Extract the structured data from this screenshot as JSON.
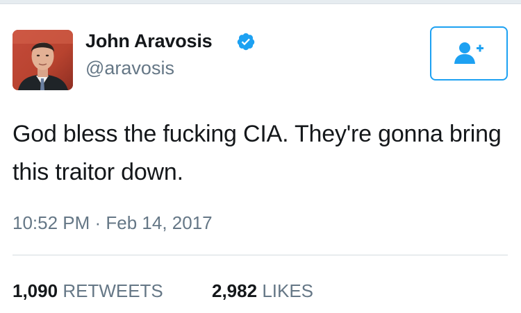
{
  "user": {
    "display_name": "John Aravosis",
    "handle": "@aravosis",
    "verified": true
  },
  "tweet": {
    "text": "God bless the fucking CIA. They're gonna bring this traitor down.",
    "timestamp": "10:52 PM · Feb 14, 2017"
  },
  "stats": {
    "retweets_count": "1,090",
    "retweets_label": "RETWEETS",
    "likes_count": "2,982",
    "likes_label": "LIKES"
  },
  "colors": {
    "accent": "#1da1f2",
    "text": "#14171a",
    "secondary": "#657786"
  },
  "icons": {
    "verified": "verified-badge-icon",
    "follow": "follow-user-plus-icon"
  }
}
